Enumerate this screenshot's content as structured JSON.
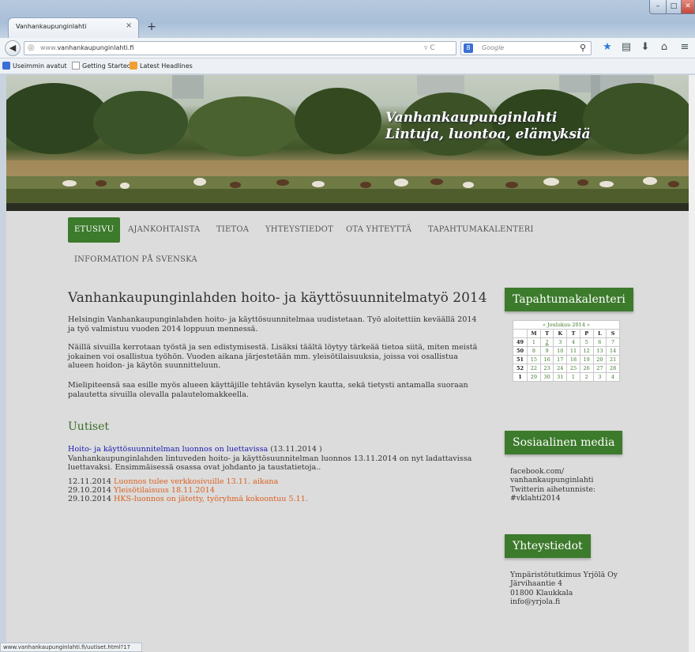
{
  "browser": {
    "tab_title": "Vanhankaupunginlahti",
    "tab_close": "×",
    "new_tab": "+",
    "url_prefix": "www.",
    "url_domain": "vanhankaupunginlahti.fi",
    "url_controls": "▿ C",
    "search_placeholder": "Google",
    "search_engine": "8",
    "bookmarks": [
      "Useimmin avatut",
      "Getting Started",
      "Latest Headlines"
    ],
    "status_url": "www.vanhankaupunginlahti.fi/uutiset.html?17"
  },
  "banner": {
    "title_line1": "Vanhankaupunginlahti",
    "title_line2": "Lintuja, luontoa, elämyksiä"
  },
  "menu": {
    "items": [
      "ETUSIVU",
      "AJANKOHTAISTA",
      "TIETOA",
      "YHTEYSTIEDOT",
      "OTA YHTEYTTÄ",
      "TAPAHTUMAKALENTERI",
      "INFORMATION PÅ SVENSKA"
    ]
  },
  "main": {
    "title": "Vanhankaupunginlahden hoito- ja käyttösuunnitelmatyö 2014",
    "paragraphs": [
      "Helsingin Vanhankaupunginlahden hoito- ja käyttösuunnitelmaa uudistetaan. Työ aloitettiin keväällä 2014 ja työ valmistuu vuoden 2014 loppuun mennessä.",
      "Näillä sivuilla kerrotaan työstä ja sen edistymisestä. Lisäksi täältä löytyy tärkeää tietoa siitä, miten meistä jokainen voi osallistua työhön. Vuoden aikana järjestetään mm. yleisötilaisuuksia, joissa voi osallistua alueen hoidon- ja käytön suunnitteluun.",
      "Mielipiteensä saa esille myös alueen käyttäjille tehtävän kyselyn kautta, sekä tietysti antamalla suoraan palautetta sivuilla olevalla palautelomakkeella."
    ],
    "news_heading": "Uutiset",
    "featured_title": "Hoito- ja käyttösuunnitelman luonnos on luettavissa",
    "featured_date": "(13.11.2014 )",
    "featured_text": "Vanhankaupunginlahden lintuveden hoito- ja käyttösuunnitelman luonnos 13.11.2014 on nyt ladattavissa luettavaksi. Ensimmäisessä osassa ovat johdanto ja taustatietoja..",
    "news_items": [
      {
        "date": "12.11.2014",
        "title": "Luonnos tulee verkkosivuille 13.11. aikana"
      },
      {
        "date": "29.10.2014",
        "title": "Yleisötilaisuus 18.11.2014"
      },
      {
        "date": "29.10.2014",
        "title": "HKS-luonnos on jätetty, työryhmä kokoontuu 5.11."
      }
    ]
  },
  "sidebar": {
    "calendar_heading": "Tapahtumakalenteri",
    "calendar_caption": "« Joulukuu 2014 »",
    "calendar_days": [
      "M",
      "T",
      "K",
      "T",
      "P",
      "L",
      "S"
    ],
    "calendar_weeks": [
      {
        "wk": "49",
        "days": [
          "1",
          "2",
          "3",
          "4",
          "5",
          "6",
          "7"
        ]
      },
      {
        "wk": "50",
        "days": [
          "8",
          "9",
          "10",
          "11",
          "12",
          "13",
          "14"
        ]
      },
      {
        "wk": "51",
        "days": [
          "15",
          "16",
          "17",
          "18",
          "19",
          "20",
          "21"
        ]
      },
      {
        "wk": "52",
        "days": [
          "22",
          "23",
          "24",
          "25",
          "26",
          "27",
          "28"
        ]
      },
      {
        "wk": "1",
        "days": [
          "29",
          "30",
          "31",
          "1",
          "2",
          "3",
          "4"
        ]
      }
    ],
    "social_heading": "Sosiaalinen media",
    "social_lines": [
      "facebook.com/",
      "vanhankaupunginlahti",
      "Twitterin aihetunniste:",
      "#vklahti2014"
    ],
    "contact_heading": "Yhteystiedot",
    "contact_lines": [
      "Ympäristötutkimus Yrjölä Oy",
      "Järvihaantie 4",
      "01800 Klaukkala",
      "info@yrjola.fi"
    ]
  },
  "colors": {
    "accent_green": "#3c7a2c",
    "link_blue": "#1a1ab0",
    "news_orange": "#d9601f"
  }
}
